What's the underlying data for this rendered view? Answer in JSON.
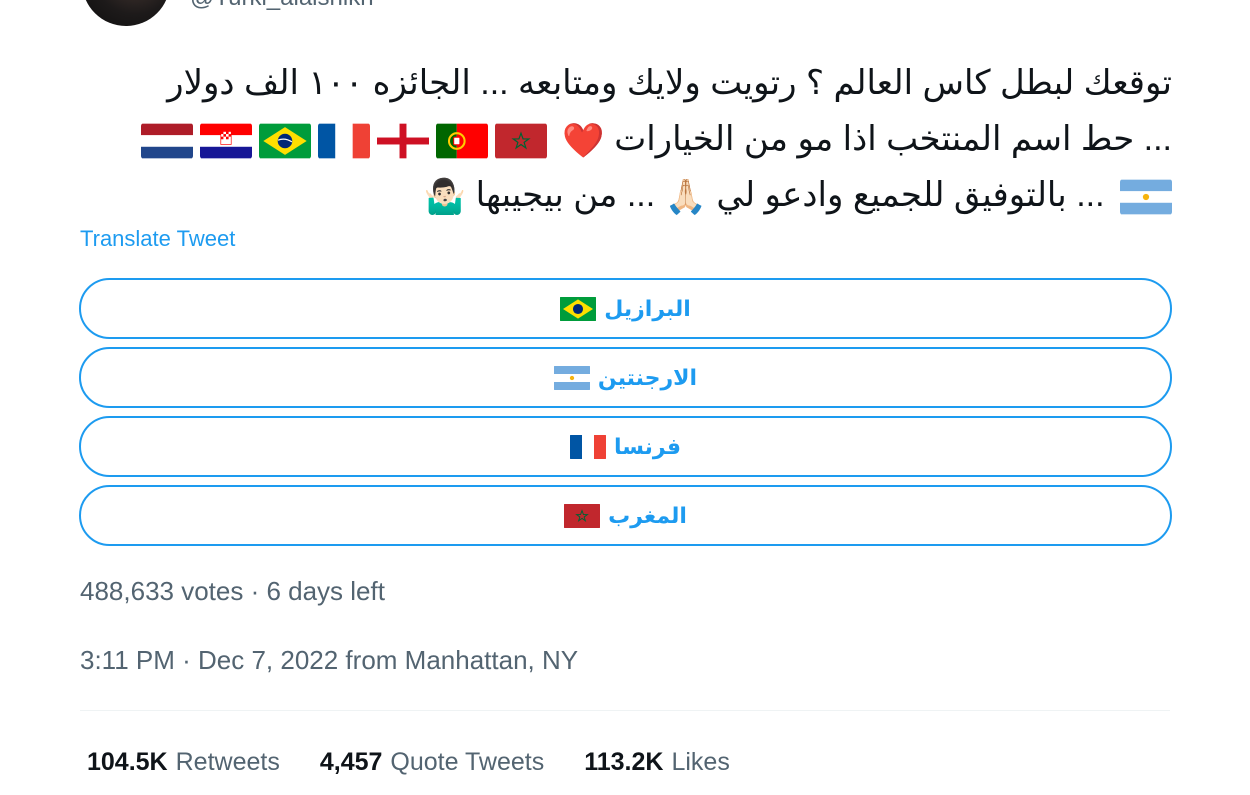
{
  "author": {
    "handle": "@Turki_alalshikh"
  },
  "tweet": {
    "line1": "توقعك لبطل كاس العالم ؟ رتويت ولايك ومتابعه ... الجائزه ١٠٠ الف دولار",
    "line2_text": "... حط اسم المنتخب اذا مو من الخيارات",
    "line2_heart": "❤️",
    "line2_flags": [
      "netherlands-flag",
      "croatia-flag",
      "brazil-flag",
      "france-flag",
      "england-flag",
      "portugal-flag",
      "morocco-flag"
    ],
    "line3_flag": "argentina-flag",
    "line3_text_a": "... بالتوفيق للجميع وادعو لي",
    "line3_pray": "🙏🏻",
    "line3_text_b": "... من بيجيبها",
    "line3_shrug": "🤷🏻‍♂️"
  },
  "translate_label": "Translate Tweet",
  "poll": {
    "options": [
      {
        "label": "البرازيل",
        "flag": "brazil-flag"
      },
      {
        "label": "الارجنتين",
        "flag": "argentina-flag"
      },
      {
        "label": "فرنسا",
        "flag": "france-flag"
      },
      {
        "label": "المغرب",
        "flag": "morocco-flag"
      }
    ],
    "meta": "488,633 votes · 6 days left"
  },
  "timestamp": "3:11 PM · Dec 7, 2022 from Manhattan, NY",
  "stats": {
    "retweets_count": "104.5K",
    "retweets_label": "Retweets",
    "quotes_count": "4,457",
    "quotes_label": "Quote Tweets",
    "likes_count": "113.2K",
    "likes_label": "Likes"
  },
  "colors": {
    "accent": "#1d9bf0",
    "secondary_text": "#536471",
    "primary_text": "#0f1419",
    "divider": "#eff3f4"
  }
}
